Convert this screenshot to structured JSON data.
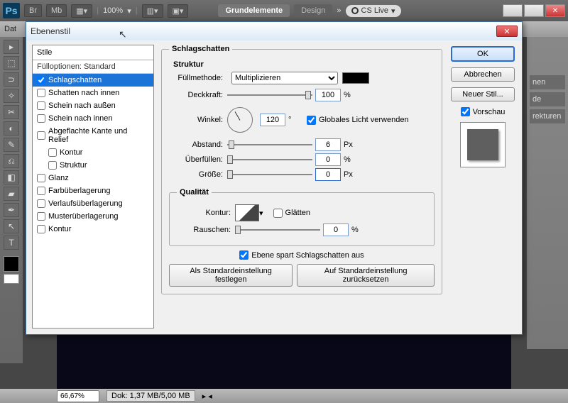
{
  "app": {
    "br": "Br",
    "mb": "Mb",
    "zoom": "100%",
    "tab_basic": "Grundelemente",
    "tab_design": "Design",
    "more": "»",
    "cslive": "CS Live"
  },
  "menubar": {
    "item0": "Dat"
  },
  "dialog": {
    "title": "Ebenenstil",
    "styles_header": "Stile",
    "fill_options": "Fülloptionen: Standard",
    "items": {
      "schlagschatten": "Schlagschatten",
      "schatten_innen": "Schatten nach innen",
      "schein_aussen": "Schein nach außen",
      "schein_innen": "Schein nach innen",
      "abgeflachte": "Abgeflachte Kante und Relief",
      "kontur": "Kontur",
      "struktur": "Struktur",
      "glanz": "Glanz",
      "farbueber": "Farbüberlagerung",
      "verlaufueber": "Verlaufsüberlagerung",
      "musterueber": "Musterüberlagerung",
      "kontur2": "Kontur"
    },
    "section": "Schlagschatten",
    "struktur_label": "Struktur",
    "fillmode_label": "Füllmethode:",
    "fillmode_value": "Multiplizieren",
    "opacity_label": "Deckkraft:",
    "opacity_value": "100",
    "opacity_unit": "%",
    "angle_label": "Winkel:",
    "angle_value": "120",
    "angle_unit": "°",
    "global_light": "Globales Licht verwenden",
    "distance_label": "Abstand:",
    "distance_value": "6",
    "distance_unit": "Px",
    "spread_label": "Überfüllen:",
    "spread_value": "0",
    "spread_unit": "%",
    "size_label": "Größe:",
    "size_value": "0",
    "size_unit": "Px",
    "quality_label": "Qualität",
    "contour_label": "Kontur:",
    "antialias": "Glätten",
    "noise_label": "Rauschen:",
    "noise_value": "0",
    "noise_unit": "%",
    "knockout": "Ebene spart Schlagschatten aus",
    "make_default": "Als Standardeinstellung festlegen",
    "reset_default": "Auf Standardeinstellung zurücksetzen",
    "ok": "OK",
    "cancel": "Abbrechen",
    "new_style": "Neuer Stil...",
    "preview": "Vorschau"
  },
  "statusbar": {
    "zoom": "66,67%",
    "doc": "Dok: 1,37 MB/5,00 MB"
  },
  "rightpanel": {
    "p1": "nen",
    "p2": "de",
    "p3": "rekturen"
  }
}
